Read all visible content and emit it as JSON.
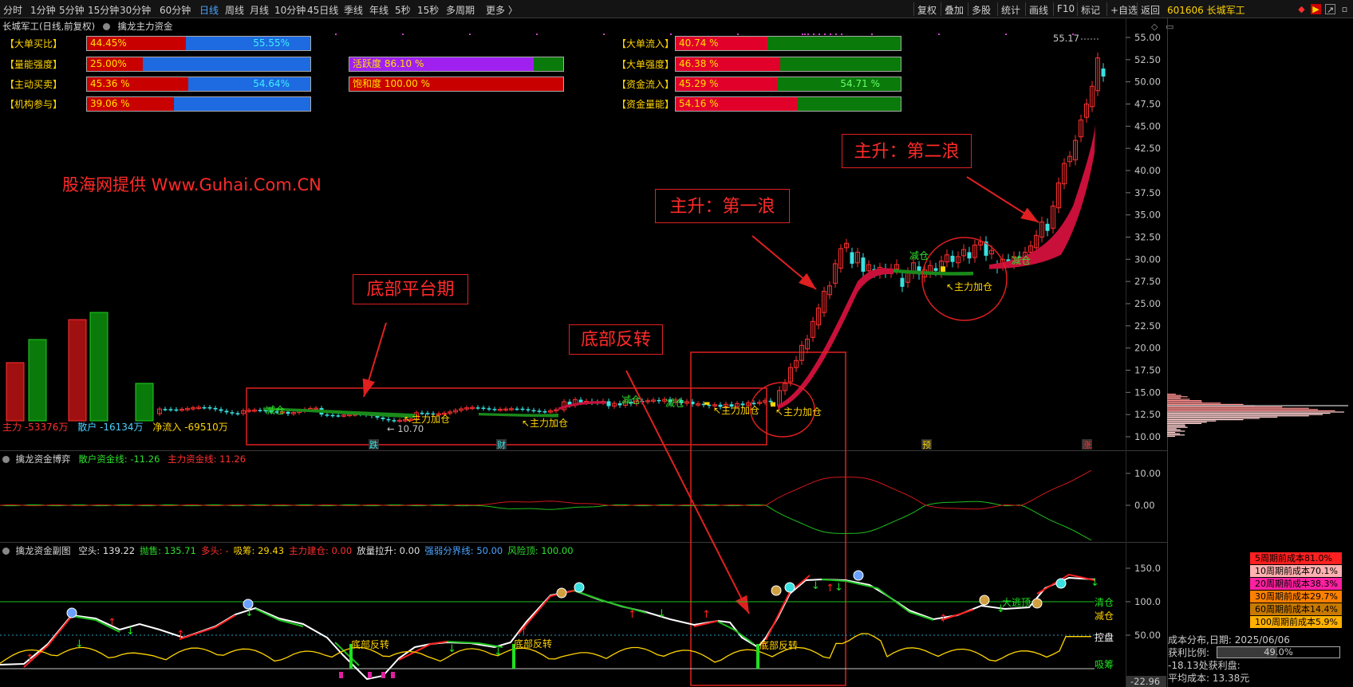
{
  "toolbar": {
    "left_items": [
      "分时",
      "1分钟",
      "5分钟",
      "15分钟",
      "30分钟",
      "60分钟",
      "日线",
      "周线",
      "月线",
      "10分钟",
      "45日线",
      "季线",
      "年线",
      "5秒",
      "15秒",
      "多周期",
      "更多 〉"
    ],
    "active": "日线",
    "right_items": [
      "复权",
      "叠加",
      "多股",
      "统计",
      "画线",
      "F10",
      "标记",
      "+自选",
      "返回"
    ],
    "stock_id": "601606 长城军工"
  },
  "main_chart": {
    "title": "长城军工(日线,前复权)",
    "indicator_name": "擒龙主力资金",
    "axis": [
      "55.00",
      "52.50",
      "50.00",
      "47.50",
      "45.00",
      "42.50",
      "40.00",
      "37.50",
      "35.00",
      "32.50",
      "30.00",
      "27.50",
      "25.00",
      "22.50",
      "20.00",
      "17.50",
      "15.00",
      "12.50",
      "10.00"
    ],
    "high_label": "55.17",
    "low_label": "10.70",
    "watermark": "股海网提供 Www.Guhai.Com.CN",
    "left_metrics": [
      {
        "label": "【大单买比】",
        "left_text": "44.45%",
        "right_text": "55.55%",
        "left_pct": 0.4445,
        "left_color": "#c80000",
        "right_color": "#1e6ae0"
      },
      {
        "label": "【量能强度】",
        "left_text": "25.00%",
        "right_text": "",
        "left_pct": 0.25,
        "left_color": "#c80000",
        "right_color": "#1e6ae0"
      },
      {
        "label": "【主动买卖】",
        "left_text": "45.36 %",
        "right_text": "54.64%",
        "left_pct": 0.4536,
        "left_color": "#c80000",
        "right_color": "#1e6ae0"
      },
      {
        "label": "【机构参与】",
        "left_text": "39.06 %",
        "right_text": "",
        "left_pct": 0.3906,
        "left_color": "#c80000",
        "right_color": "#1e6ae0"
      }
    ],
    "mid_metrics": [
      {
        "left_text": "活跃度 86.10 %",
        "left_pct": 0.861,
        "left_color": "#a020f0",
        "right_color": "#0a7a0a"
      },
      {
        "left_text": "饱和度 100.00 %",
        "left_pct": 1.0,
        "left_color": "#c80000",
        "right_color": "#0a7a0a"
      }
    ],
    "right_metrics": [
      {
        "label": "【大单流入】",
        "left_text": "40.74 %",
        "right_text": "",
        "left_pct": 0.4074,
        "left_color": "#e0002a",
        "right_color": "#0a7a0a"
      },
      {
        "label": "【大单强度】",
        "left_text": "46.38 %",
        "right_text": "",
        "left_pct": 0.4638,
        "left_color": "#e0002a",
        "right_color": "#0a7a0a"
      },
      {
        "label": "【资金流入】",
        "left_text": "45.29 %",
        "right_text": "54.71 %",
        "left_pct": 0.4529,
        "left_color": "#e0002a",
        "right_color": "#0a7a0a"
      },
      {
        "label": "【资金量能】",
        "left_text": "54.16 %",
        "right_text": "",
        "left_pct": 0.5416,
        "left_color": "#e0002a",
        "right_color": "#0a7a0a"
      }
    ],
    "legend": {
      "main_label": "主力",
      "main_value": "-53376万",
      "retail_label": "散户",
      "retail_value": "-16134万",
      "net_label": "净流入",
      "net_value": "-69510万"
    },
    "annotations": {
      "platform": "底部平台期",
      "reversal": "底部反转",
      "wave1": "主升：第一浪",
      "wave2": "主升：第二浪"
    },
    "markers": {
      "jian": "减仓",
      "jia": "主力加仓",
      "die": "跌",
      "cai": "财",
      "yu": "预",
      "zhang": "涨"
    }
  },
  "sub1": {
    "title": "擒龙资金博弈",
    "retail_label": "散户资金线:",
    "retail_value": "-11.26",
    "main_label": "主力资金线:",
    "main_value": "11.26",
    "axis": [
      "10.00",
      "0.00"
    ]
  },
  "sub2": {
    "title": "擒龙资金副图",
    "items": [
      {
        "label": "空头:",
        "value": "139.22",
        "color": "#e0e0e0"
      },
      {
        "label": "抛售:",
        "value": "135.71",
        "color": "#2ee02e"
      },
      {
        "label": "多头:",
        "value": "-",
        "color": "#ff3030"
      },
      {
        "label": "吸筹:",
        "value": "29.43",
        "color": "#ffd400"
      },
      {
        "label": "主力建仓:",
        "value": "0.00",
        "color": "#ff3030"
      },
      {
        "label": "放量拉升:",
        "value": "0.00",
        "color": "#e0e0e0"
      },
      {
        "label": "强弱分界线:",
        "value": "50.00",
        "color": "#4aa3ff"
      },
      {
        "label": "风险顶:",
        "value": "100.00",
        "color": "#2ee02e"
      }
    ],
    "axis": [
      "150.0",
      "100.0",
      "50.00"
    ],
    "low_axis": "-22.96",
    "right_labels": {
      "qing": "清仓",
      "jian": "减仓",
      "kong": "控盘",
      "xi": "吸筹"
    },
    "markers": {
      "rev": "底部反转",
      "top": "大逃顶"
    }
  },
  "cost_panel": {
    "rows": [
      {
        "text": "5周期前成本81.0%",
        "color": "#ff2020"
      },
      {
        "text": "10周期前成本70.1%",
        "color": "#ffb0b0"
      },
      {
        "text": "20周期前成本38.3%",
        "color": "#ff20a0"
      },
      {
        "text": "30周期前成本29.7%",
        "color": "#ff8000"
      },
      {
        "text": "60周期前成本14.4%",
        "color": "#c87a00"
      },
      {
        "text": "100周期前成本5.9%",
        "color": "#ffb000"
      }
    ],
    "date_label": "成本分布,日期:",
    "date_value": "2025/06/06",
    "profit_label": "获利比例:",
    "profit_value": "49.0%",
    "profit_pct": 0.49,
    "profit_line": "-18.13处获利盘:",
    "avg_label": "平均成本:",
    "avg_value": "13.38元"
  }
}
